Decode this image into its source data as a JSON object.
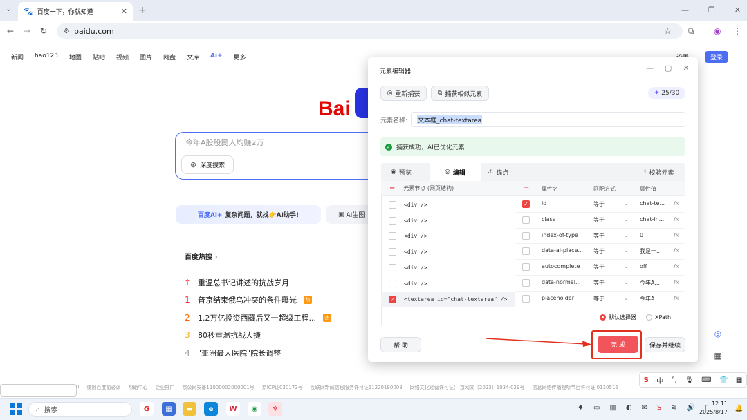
{
  "browser": {
    "tab_title": "百度一下，你就知道",
    "url": "baidu.com",
    "new_tab": "+"
  },
  "baidu": {
    "nav": [
      "新闻",
      "hao123",
      "地图",
      "贴吧",
      "视频",
      "图片",
      "网盘",
      "文库",
      "Ai+",
      "更多"
    ],
    "settings": "设置",
    "login": "登录",
    "logo": "Bai",
    "search_placeholder": "今年A股股民人均赚2万",
    "deep_search": "深度搜索",
    "ai_banner_brand": "百度Ai+",
    "ai_banner_text": "复杂问题，就找👉AI助手!",
    "ai_image": "AI生图",
    "hot_title": "百度热搜",
    "hot": [
      {
        "rank": "↑",
        "text": "重温总书记讲述的抗战岁月",
        "badge": ""
      },
      {
        "rank": "1",
        "text": "普京结束俄乌冲突的条件曝光",
        "badge": "热"
      },
      {
        "rank": "2",
        "text": "1.2万亿投资西藏后又一超级工程...",
        "badge": "热"
      },
      {
        "rank": "3",
        "text": "80秒重温抗战大捷",
        "badge": ""
      },
      {
        "rank": "4",
        "text": "\"亚洲最大医院\"院长调整",
        "badge": ""
      }
    ],
    "footer": [
      "使用百度前必读",
      "帮助中心",
      "企业推广",
      "京公网安备11000002000001号",
      "京ICP证030173号",
      "互联网新闻信息服务许可证11220180008",
      "网络文化经营许可证： 京网文〔2023〕1034-029号",
      "信息网络传播视听节目许可证 0110516"
    ],
    "footer_prefix": "u"
  },
  "editor": {
    "title": "元素编辑器",
    "recapture": "重新捕获",
    "capture_similar": "捕获相似元素",
    "quota": "25/30",
    "name_label": "元素名称:",
    "name_value": "文本框_chat-textarea",
    "success_msg": "捕获成功，AI已优化元素",
    "tabs": [
      "预览",
      "编辑",
      "锚点"
    ],
    "verify": "校验元素",
    "left_header": "元素节点 (网页结构)",
    "nodes": [
      {
        "text": "<div />",
        "checked": false
      },
      {
        "text": "<div />",
        "checked": false
      },
      {
        "text": "<div />",
        "checked": false
      },
      {
        "text": "<div />",
        "checked": false
      },
      {
        "text": "<div />",
        "checked": false
      },
      {
        "text": "<div />",
        "checked": false
      },
      {
        "text": "<textarea id=\"chat-textarea\" />",
        "checked": true
      }
    ],
    "right_headers": [
      "属性名",
      "匹配方式",
      "属性值"
    ],
    "attrs": [
      {
        "name": "id",
        "match": "等于",
        "value": "chat-te...",
        "checked": true
      },
      {
        "name": "class",
        "match": "等于",
        "value": "chat-in...",
        "checked": false
      },
      {
        "name": "index-of-type",
        "match": "等于",
        "value": "0",
        "checked": false
      },
      {
        "name": "data-ai-place...",
        "match": "等于",
        "value": "我是一...",
        "checked": false
      },
      {
        "name": "autocomplete",
        "match": "等于",
        "value": "off",
        "checked": false
      },
      {
        "name": "data-normal...",
        "match": "等于",
        "value": "今年A...",
        "checked": false
      },
      {
        "name": "placeholder",
        "match": "等于",
        "value": "今年A...",
        "checked": false
      }
    ],
    "fx": "fx",
    "selector_default": "默认选择器",
    "selector_xpath": "XPath",
    "help": "帮 助",
    "done": "完 成",
    "save_continue": "保存并继续"
  },
  "ime": {
    "s": "S",
    "zh": "中"
  },
  "taskbar": {
    "search": "搜索",
    "time": "12:11",
    "date": "2025/8/17"
  },
  "colors": {
    "baidu_blue": "#4e6ef2",
    "done_red": "#f2545b",
    "highlight": "#e0311e"
  }
}
